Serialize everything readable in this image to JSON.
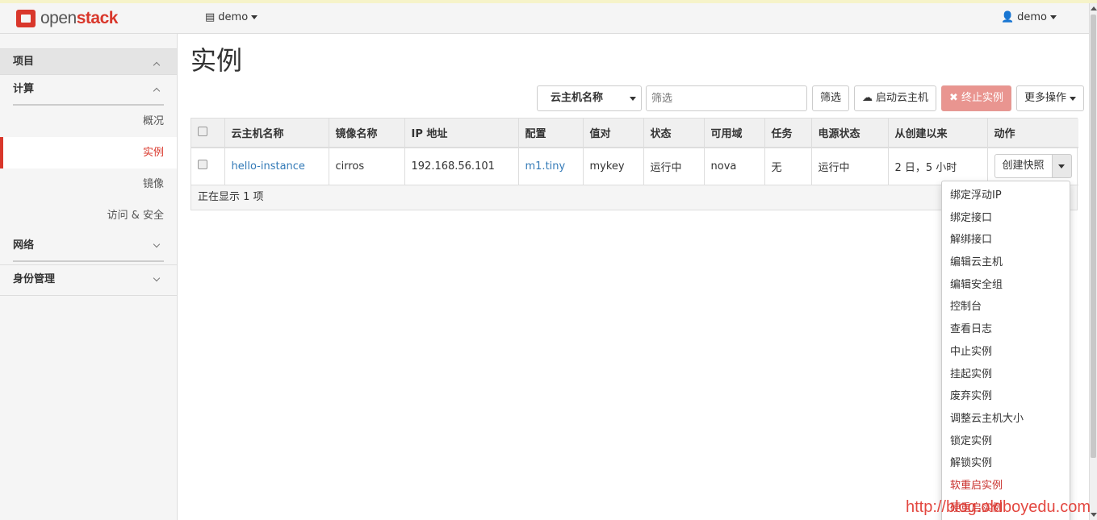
{
  "navbar": {
    "brand_prefix": "open",
    "brand_suffix": "stack",
    "project_label": "demo",
    "user_label": "demo"
  },
  "sidebar": {
    "project": "项目",
    "compute": "计算",
    "items": [
      "概况",
      "实例",
      "镜像",
      "访问 & 安全"
    ],
    "active_item": "实例",
    "network": "网络",
    "identity": "身份管理"
  },
  "page": {
    "title": "实例"
  },
  "toolbar": {
    "filter_field": "云主机名称",
    "filter_placeholder": "筛选",
    "filter_button": "筛选",
    "launch_button": "启动云主机",
    "terminate_button": "终止实例",
    "more_actions": "更多操作"
  },
  "table": {
    "headers": [
      "云主机名称",
      "镜像名称",
      "IP 地址",
      "配置",
      "值对",
      "状态",
      "可用域",
      "任务",
      "电源状态",
      "从创建以来",
      "动作"
    ],
    "rows": [
      {
        "name": "hello-instance",
        "image": "cirros",
        "ip": "192.168.56.101",
        "flavor": "m1.tiny",
        "keypair": "mykey",
        "status": "运行中",
        "zone": "nova",
        "task": "无",
        "power": "运行中",
        "age": "2 日，5 小时",
        "action": "创建快照"
      }
    ],
    "footer": "正在显示 1 项"
  },
  "dropdown": {
    "items": [
      "绑定浮动IP",
      "绑定接口",
      "解绑接口",
      "编辑云主机",
      "编辑安全组",
      "控制台",
      "查看日志",
      "中止实例",
      "挂起实例",
      "废弃实例",
      "调整云主机大小",
      "锁定实例",
      "解锁实例",
      "软重启实例",
      "硬重启实例"
    ]
  },
  "watermark": "http://blog.oldboyedu.com",
  "colors": {
    "accent": "#d9372b",
    "link": "#337ab7",
    "danger_button": "#e99590"
  }
}
